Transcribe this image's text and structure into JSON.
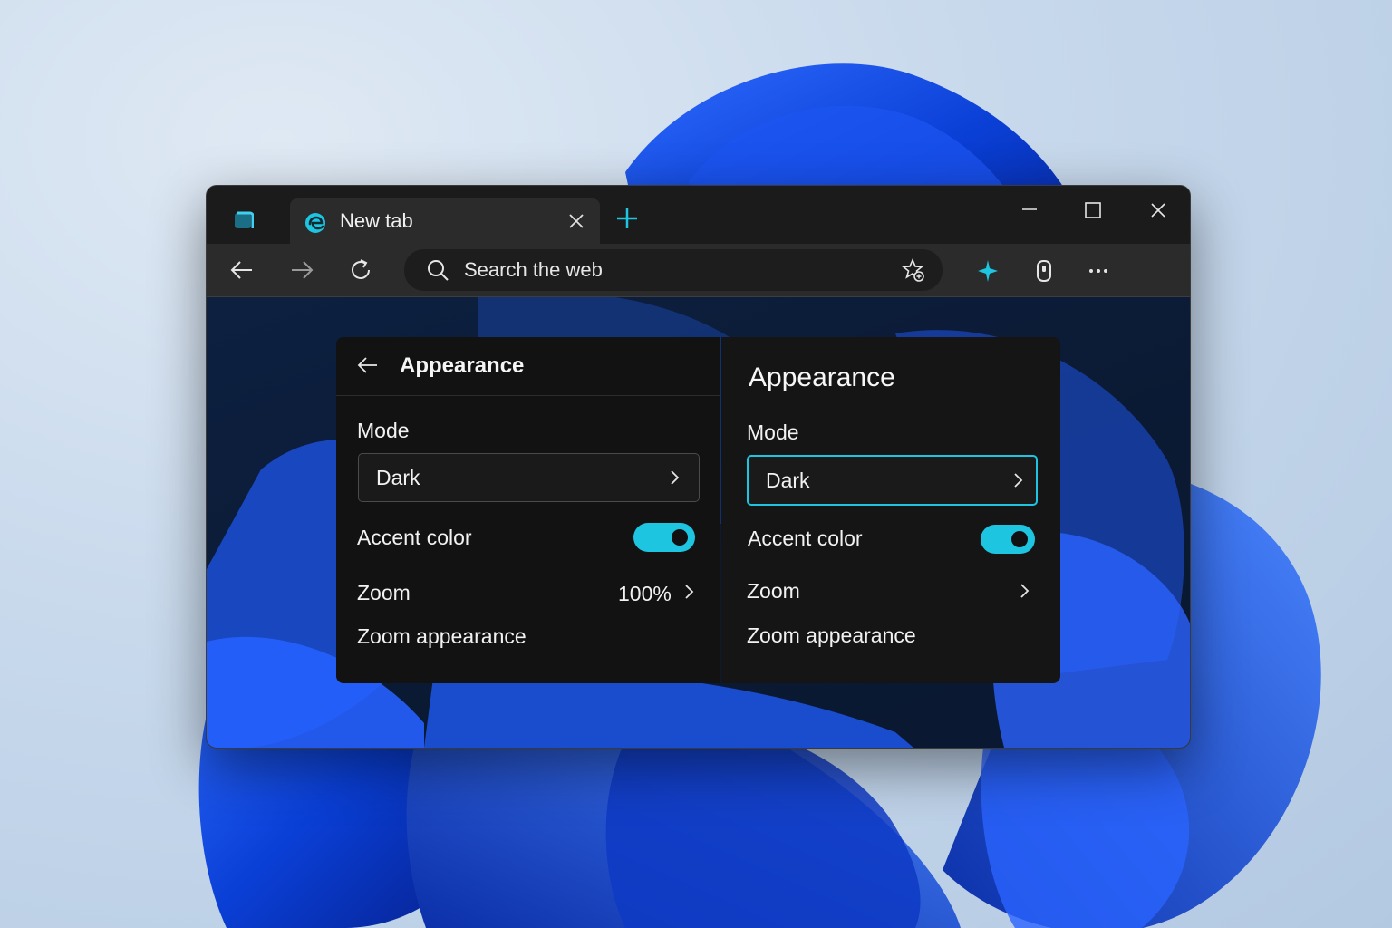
{
  "browser": {
    "tab": {
      "title": "New tab"
    },
    "address_bar": {
      "placeholder": "Search the web"
    },
    "accent_color": "#1ec5e0"
  },
  "settings_left": {
    "header_title": "Appearance",
    "mode_label": "Mode",
    "mode_value": "Dark",
    "accent_label": "Accent color",
    "accent_enabled": true,
    "zoom_label": "Zoom",
    "zoom_value": "100%",
    "zoom_appearance_label": "Zoom appearance"
  },
  "settings_right": {
    "title": "Appearance",
    "mode_label": "Mode",
    "mode_value": "Dark",
    "accent_label": "Accent color",
    "accent_enabled": true,
    "zoom_label": "Zoom",
    "zoom_appearance_label": "Zoom appearance"
  }
}
